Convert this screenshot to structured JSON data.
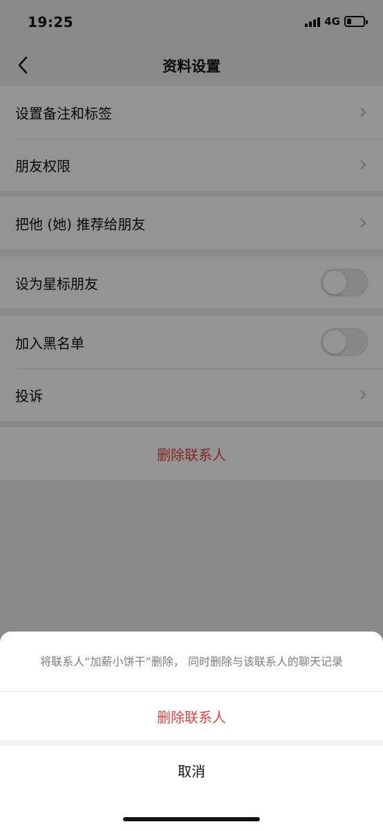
{
  "status_bar": {
    "time": "19:25",
    "network": "4G",
    "icons": [
      "signal-icon",
      "battery-icon"
    ]
  },
  "nav": {
    "title": "资料设置",
    "back_icon": "chevron-left-icon"
  },
  "settings": {
    "group1": [
      {
        "label": "设置备注和标签",
        "accessory": "chevron"
      },
      {
        "label": "朋友权限",
        "accessory": "chevron"
      }
    ],
    "group2": [
      {
        "label": "把他 (她) 推荐给朋友",
        "accessory": "chevron"
      }
    ],
    "group3": [
      {
        "label": "设为星标朋友",
        "accessory": "toggle",
        "on": false
      }
    ],
    "group4": [
      {
        "label": "加入黑名单",
        "accessory": "toggle",
        "on": false
      },
      {
        "label": "投诉",
        "accessory": "chevron"
      }
    ],
    "delete_label": "删除联系人"
  },
  "action_sheet": {
    "message": "将联系人“加薪小饼干”删除， 同时删除与该联系人的聊天记录",
    "confirm_label": "删除联系人",
    "cancel_label": "取消"
  },
  "colors": {
    "danger": "#e64340",
    "background": "#ededed",
    "overlay": "rgba(0,0,0,0.42)"
  }
}
